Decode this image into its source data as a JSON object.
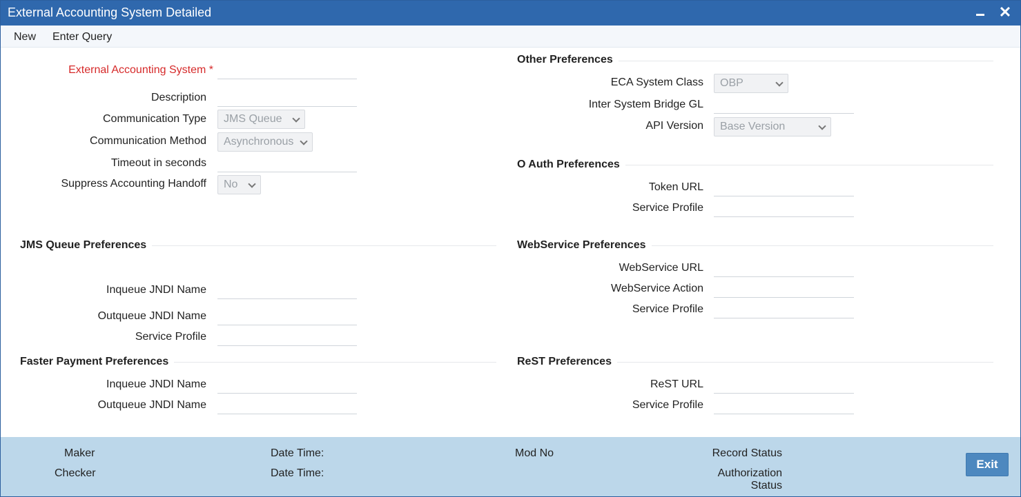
{
  "window": {
    "title": "External Accounting System Detailed"
  },
  "menu": {
    "new": "New",
    "enter_query": "Enter Query"
  },
  "main": {
    "external_accounting_system": {
      "label": "External Accounting System",
      "required_mark": "*",
      "value": ""
    },
    "description": {
      "label": "Description",
      "value": ""
    },
    "communication_type": {
      "label": "Communication Type",
      "value": "JMS Queue"
    },
    "communication_method": {
      "label": "Communication Method",
      "value": "Asynchronous"
    },
    "timeout": {
      "label": "Timeout in seconds",
      "value": ""
    },
    "suppress_handoff": {
      "label": "Suppress Accounting Handoff",
      "value": "No"
    }
  },
  "other_preferences": {
    "title": "Other Preferences",
    "eca_system_class": {
      "label": "ECA System Class",
      "value": "OBP"
    },
    "inter_system_bridge_gl": {
      "label": "Inter System Bridge GL",
      "value": ""
    },
    "api_version": {
      "label": "API Version",
      "value": "Base Version"
    }
  },
  "oauth_preferences": {
    "title": "O Auth Preferences",
    "token_url": {
      "label": "Token URL",
      "value": ""
    },
    "service_profile": {
      "label": "Service Profile",
      "value": ""
    }
  },
  "jms_preferences": {
    "title": "JMS Queue Preferences",
    "inqueue": {
      "label": "Inqueue JNDI Name",
      "value": ""
    },
    "outqueue": {
      "label": "Outqueue JNDI Name",
      "value": ""
    },
    "service_profile": {
      "label": "Service Profile",
      "value": ""
    }
  },
  "webservice_preferences": {
    "title": "WebService Preferences",
    "url": {
      "label": "WebService URL",
      "value": ""
    },
    "action": {
      "label": "WebService Action",
      "value": ""
    },
    "service_profile": {
      "label": "Service Profile",
      "value": ""
    }
  },
  "faster_payment_preferences": {
    "title": "Faster Payment Preferences",
    "inqueue": {
      "label": "Inqueue JNDI Name",
      "value": ""
    },
    "outqueue": {
      "label": "Outqueue JNDI Name",
      "value": ""
    }
  },
  "rest_preferences": {
    "title": "ReST Preferences",
    "url": {
      "label": "ReST URL",
      "value": ""
    },
    "service_profile": {
      "label": "Service Profile",
      "value": ""
    }
  },
  "footer": {
    "maker": "Maker",
    "checker": "Checker",
    "date_time_1": "Date Time:",
    "date_time_2": "Date Time:",
    "mod_no": "Mod No",
    "record_status": "Record Status",
    "authorization_status_1": "Authorization",
    "authorization_status_2": "Status",
    "exit": "Exit"
  }
}
